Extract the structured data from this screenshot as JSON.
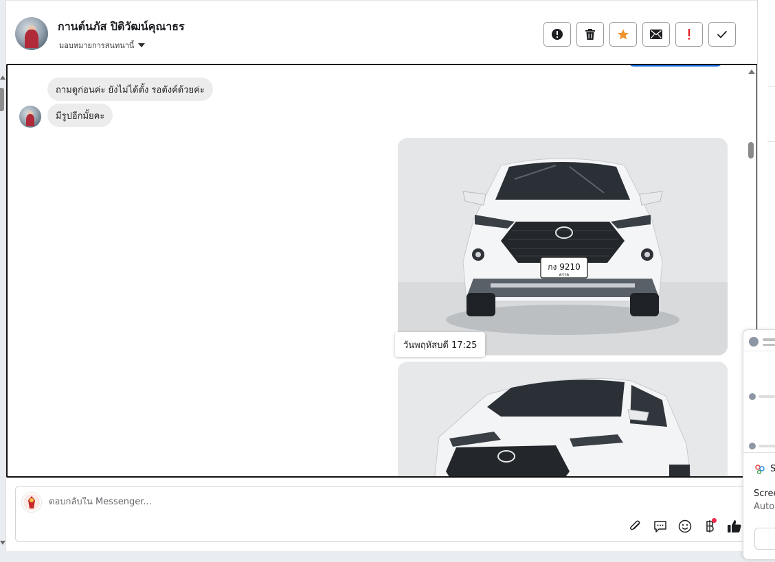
{
  "header": {
    "name": "กานต์นภัส ปิติวัฒน์คุณาธร",
    "assign_label": "มอบหมายการสนทนานี้"
  },
  "actions": [
    {
      "name": "report-button",
      "icon": "alert-circle-icon"
    },
    {
      "name": "delete-button",
      "icon": "trash-icon"
    },
    {
      "name": "star-button",
      "icon": "star-icon",
      "color": "#f0932b"
    },
    {
      "name": "mark-unread-button",
      "icon": "envelope-icon"
    },
    {
      "name": "flag-button",
      "icon": "exclamation-icon",
      "color": "#e02020"
    },
    {
      "name": "done-button",
      "icon": "checkmark-icon"
    }
  ],
  "messages": [
    {
      "text": "ถามดูก่อนค่ะ ยังไม่ได้ตั้ง รอตังค์ด้วยค่ะ"
    },
    {
      "text": "มีรูปอีกมั้ยคะ"
    }
  ],
  "photos": [
    {
      "plate": "กง 9210",
      "province": "ตราด"
    },
    {
      "plate": ""
    }
  ],
  "timestamp": "วันพฤหัสบดี 17:25",
  "composer": {
    "placeholder": "ตอบกลับใน Messenger..."
  },
  "widget": {
    "label_s": "S",
    "line1": "Scree",
    "line2": "Auto"
  },
  "colors": {
    "accent": "#1a73e8",
    "bubble": "#ececec",
    "star": "#f0932b",
    "flag": "#e02020"
  }
}
